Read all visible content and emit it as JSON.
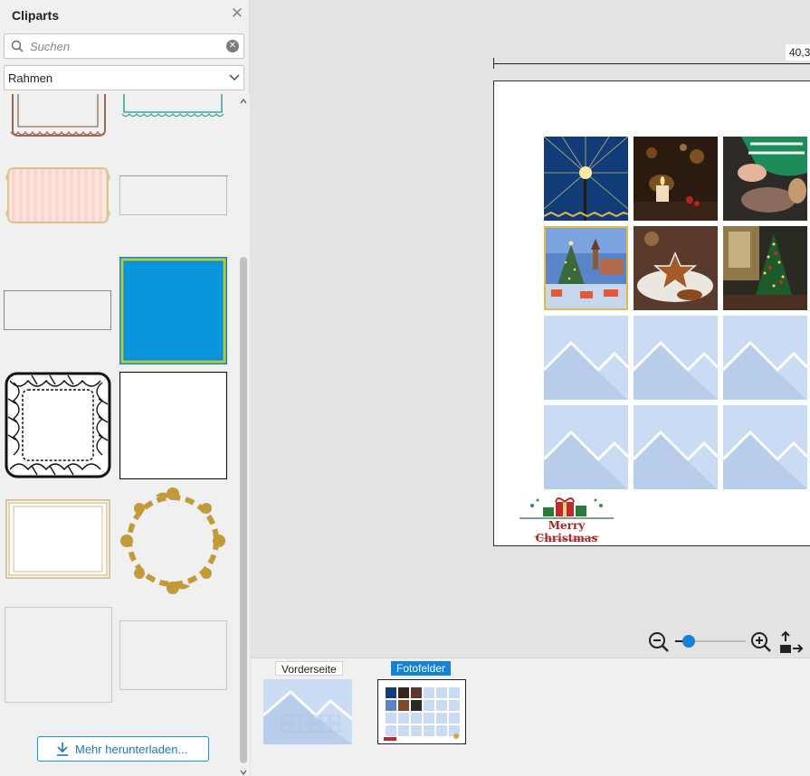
{
  "panel": {
    "title": "Cliparts",
    "search_placeholder": "Suchen",
    "category": "Rahmen",
    "download_label": "Mehr herunterladen..."
  },
  "canvas": {
    "ruler_label": "40,3",
    "logo_text": "Merry Christmas"
  },
  "pages": [
    {
      "label": "Vorderseite",
      "active": false
    },
    {
      "label": "Fotofelder",
      "active": true
    }
  ],
  "colors": {
    "accent": "#1283d6",
    "selected_frame": "#e4b84a",
    "placeholder": "#c9dcf4"
  }
}
